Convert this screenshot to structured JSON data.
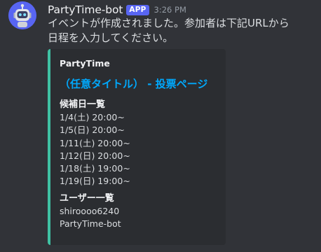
{
  "message": {
    "username": "PartyTime-bot",
    "app_tag": "APP",
    "timestamp": "3:26 PM",
    "content": "イベントが作成されました。参加者は下記URLから日程を入力してください。"
  },
  "embed": {
    "author": "PartyTime",
    "title": "（任意タイトル） - 投票ページ",
    "fields": [
      {
        "name": "候補日一覧",
        "values": [
          "1/4(土) 20:00~",
          "1/5(日) 20:00~",
          "1/11(土) 20:00~",
          "1/12(日) 20:00~",
          "1/18(土) 19:00~",
          "1/19(日) 19:00~"
        ]
      },
      {
        "name": "ユーザー一覧",
        "values": [
          "shiroooo6240",
          "PartyTime-bot"
        ]
      }
    ]
  },
  "colors": {
    "background": "#313338",
    "embed_background": "#2b2d31",
    "embed_accent": "#3fc1a3",
    "link": "#00a8fc",
    "app_tag": "#5865f2",
    "avatar": "#5865f2"
  },
  "icons": {
    "avatar": "robot-avatar-icon"
  }
}
